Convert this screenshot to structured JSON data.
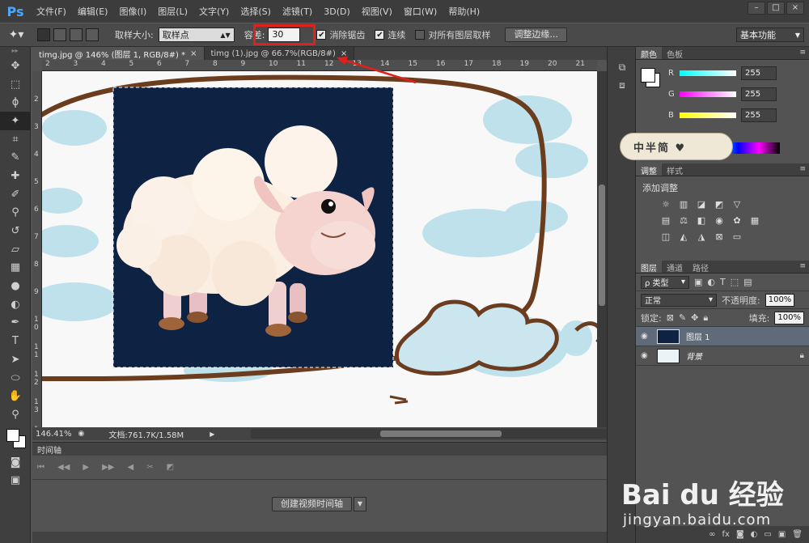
{
  "app": {
    "logo": "Ps"
  },
  "menu": [
    "文件(F)",
    "编辑(E)",
    "图像(I)",
    "图层(L)",
    "文字(Y)",
    "选择(S)",
    "滤镜(T)",
    "3D(D)",
    "视图(V)",
    "窗口(W)",
    "帮助(H)"
  ],
  "window_buttons": {
    "min": "–",
    "max": "□",
    "close": "×"
  },
  "options": {
    "sample_size_label": "取样大小:",
    "sample_size_value": "取样点",
    "tolerance_label": "容差:",
    "tolerance_value": "30",
    "antialias_label": "消除锯齿",
    "contiguous_label": "连续",
    "all_layers_label": "对所有图层取样",
    "refine_edge_label": "调整边缘...",
    "workspace_value": "基本功能"
  },
  "doc_tabs": [
    {
      "label": "timg.jpg @ 146% (图层 1, RGB/8#) *",
      "active": true
    },
    {
      "label": "timg (1).jpg @ 66.7%(RGB/8#)",
      "active": false
    }
  ],
  "ruler_top": [
    "2",
    "3",
    "4",
    "5",
    "6",
    "7",
    "8",
    "9",
    "10",
    "11",
    "12",
    "13",
    "14",
    "15",
    "16",
    "17",
    "18",
    "19",
    "20",
    "21"
  ],
  "ruler_left": [
    "2",
    "3",
    "4",
    "5",
    "6",
    "7",
    "8",
    "9",
    "1 0",
    "1 1",
    "1 2",
    "1 3",
    "1 4"
  ],
  "status": {
    "zoom": "146.41%",
    "doc": "文档:761.7K/1.58M"
  },
  "timeline": {
    "title": "时间轴",
    "create_button": "创建视频时间轴"
  },
  "color_panel": {
    "tabs": [
      "颜色",
      "色板"
    ],
    "r_label": "R",
    "r_value": "255",
    "g_label": "G",
    "g_value": "255",
    "b_label": "B",
    "b_value": "255",
    "sticker_text": "中半简 ♥"
  },
  "adjust_panel": {
    "tabs": [
      "调整",
      "样式"
    ],
    "title": "添加调整"
  },
  "layers_panel": {
    "tabs": [
      "图层",
      "通道",
      "路径"
    ],
    "kind_label": "ρ 类型",
    "blend_mode": "正常",
    "opacity_label": "不透明度:",
    "opacity_value": "100%",
    "lock_label": "锁定:",
    "fill_label": "填充:",
    "fill_value": "100%",
    "layers": [
      {
        "name": "图层 1",
        "selected": true
      },
      {
        "name": "背景",
        "selected": false,
        "locked": true
      }
    ]
  },
  "watermark": {
    "brand": "Bai du 经验",
    "url": "jingyan.baidu.com"
  },
  "colors": {
    "accent_red": "#e0201c",
    "ps_blue": "#4aa8ff",
    "canvas_navy": "#0e2244",
    "cloud_blue": "#bfe1ec",
    "frame_brown": "#6b3d1e"
  }
}
